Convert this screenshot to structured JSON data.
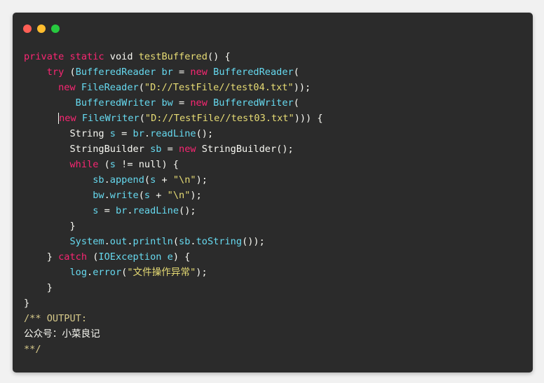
{
  "window": {
    "background": "#2b2b2b",
    "page_background": "#f1f1f1",
    "controls": [
      {
        "name": "close",
        "color": "#ff5f56"
      },
      {
        "name": "minimize",
        "color": "#ffbd2e"
      },
      {
        "name": "zoom",
        "color": "#27c93f"
      }
    ]
  },
  "code": {
    "lines": [
      [
        {
          "t": "private",
          "c": "kw"
        },
        {
          "t": " ",
          "c": "pl"
        },
        {
          "t": "static",
          "c": "kw"
        },
        {
          "t": " ",
          "c": "pl"
        },
        {
          "t": "void",
          "c": "pl"
        },
        {
          "t": " ",
          "c": "pl"
        },
        {
          "t": "testBuffered",
          "c": "fn"
        },
        {
          "t": "() {",
          "c": "pl"
        }
      ],
      [
        {
          "t": "    ",
          "c": "pl"
        },
        {
          "t": "try",
          "c": "kw"
        },
        {
          "t": " (",
          "c": "pl"
        },
        {
          "t": "BufferedReader",
          "c": "ty"
        },
        {
          "t": " ",
          "c": "pl"
        },
        {
          "t": "br",
          "c": "idn"
        },
        {
          "t": " = ",
          "c": "pl"
        },
        {
          "t": "new",
          "c": "kw"
        },
        {
          "t": " ",
          "c": "pl"
        },
        {
          "t": "BufferedReader",
          "c": "ty"
        },
        {
          "t": "(",
          "c": "pl"
        }
      ],
      [
        {
          "t": "      ",
          "c": "pl"
        },
        {
          "t": "new",
          "c": "kw"
        },
        {
          "t": " ",
          "c": "pl"
        },
        {
          "t": "FileReader",
          "c": "ty"
        },
        {
          "t": "(",
          "c": "pl"
        },
        {
          "t": "\"D://TestFile//test04.txt\"",
          "c": "str"
        },
        {
          "t": "));",
          "c": "pl"
        }
      ],
      [
        {
          "t": "         ",
          "c": "pl"
        },
        {
          "t": "BufferedWriter",
          "c": "ty"
        },
        {
          "t": " ",
          "c": "pl"
        },
        {
          "t": "bw",
          "c": "idn"
        },
        {
          "t": " = ",
          "c": "pl"
        },
        {
          "t": "new",
          "c": "kw"
        },
        {
          "t": " ",
          "c": "pl"
        },
        {
          "t": "BufferedWriter",
          "c": "ty"
        },
        {
          "t": "(",
          "c": "pl"
        }
      ],
      [
        {
          "t": "      ",
          "c": "pl"
        },
        {
          "t": "new",
          "c": "kw",
          "cursor": true
        },
        {
          "t": " ",
          "c": "pl"
        },
        {
          "t": "FileWriter",
          "c": "ty"
        },
        {
          "t": "(",
          "c": "pl"
        },
        {
          "t": "\"D://TestFile//test03.txt\"",
          "c": "str"
        },
        {
          "t": "))) {",
          "c": "pl"
        }
      ],
      [
        {
          "t": "        ",
          "c": "pl"
        },
        {
          "t": "String",
          "c": "pl"
        },
        {
          "t": " ",
          "c": "pl"
        },
        {
          "t": "s",
          "c": "idn"
        },
        {
          "t": " = ",
          "c": "pl"
        },
        {
          "t": "br",
          "c": "idn"
        },
        {
          "t": ".",
          "c": "pl"
        },
        {
          "t": "readLine",
          "c": "idn"
        },
        {
          "t": "();",
          "c": "pl"
        }
      ],
      [
        {
          "t": "        ",
          "c": "pl"
        },
        {
          "t": "StringBuilder",
          "c": "pl"
        },
        {
          "t": " ",
          "c": "pl"
        },
        {
          "t": "sb",
          "c": "idn"
        },
        {
          "t": " = ",
          "c": "pl"
        },
        {
          "t": "new",
          "c": "kw"
        },
        {
          "t": " ",
          "c": "pl"
        },
        {
          "t": "StringBuilder",
          "c": "pl"
        },
        {
          "t": "();",
          "c": "pl"
        }
      ],
      [
        {
          "t": "        ",
          "c": "pl"
        },
        {
          "t": "while",
          "c": "kw"
        },
        {
          "t": " (",
          "c": "pl"
        },
        {
          "t": "s",
          "c": "idn"
        },
        {
          "t": " != null) {",
          "c": "pl"
        }
      ],
      [
        {
          "t": "            ",
          "c": "pl"
        },
        {
          "t": "sb",
          "c": "idn"
        },
        {
          "t": ".",
          "c": "pl"
        },
        {
          "t": "append",
          "c": "idn"
        },
        {
          "t": "(",
          "c": "pl"
        },
        {
          "t": "s",
          "c": "idn"
        },
        {
          "t": " + ",
          "c": "pl"
        },
        {
          "t": "\"\\n\"",
          "c": "str"
        },
        {
          "t": ");",
          "c": "pl"
        }
      ],
      [
        {
          "t": "            ",
          "c": "pl"
        },
        {
          "t": "bw",
          "c": "idn"
        },
        {
          "t": ".",
          "c": "pl"
        },
        {
          "t": "write",
          "c": "idn"
        },
        {
          "t": "(",
          "c": "pl"
        },
        {
          "t": "s",
          "c": "idn"
        },
        {
          "t": " + ",
          "c": "pl"
        },
        {
          "t": "\"\\n\"",
          "c": "str"
        },
        {
          "t": ");",
          "c": "pl"
        }
      ],
      [
        {
          "t": "            ",
          "c": "pl"
        },
        {
          "t": "s",
          "c": "idn"
        },
        {
          "t": " = ",
          "c": "pl"
        },
        {
          "t": "br",
          "c": "idn"
        },
        {
          "t": ".",
          "c": "pl"
        },
        {
          "t": "readLine",
          "c": "idn"
        },
        {
          "t": "();",
          "c": "pl"
        }
      ],
      [
        {
          "t": "        }",
          "c": "pl"
        }
      ],
      [
        {
          "t": "        ",
          "c": "pl"
        },
        {
          "t": "System",
          "c": "idn"
        },
        {
          "t": ".",
          "c": "pl"
        },
        {
          "t": "out",
          "c": "idn"
        },
        {
          "t": ".",
          "c": "pl"
        },
        {
          "t": "println",
          "c": "idn"
        },
        {
          "t": "(",
          "c": "pl"
        },
        {
          "t": "sb",
          "c": "idn"
        },
        {
          "t": ".",
          "c": "pl"
        },
        {
          "t": "toString",
          "c": "idn"
        },
        {
          "t": "());",
          "c": "pl"
        }
      ],
      [
        {
          "t": "    } ",
          "c": "pl"
        },
        {
          "t": "catch",
          "c": "kw"
        },
        {
          "t": " (",
          "c": "pl"
        },
        {
          "t": "IOException",
          "c": "ty"
        },
        {
          "t": " ",
          "c": "pl"
        },
        {
          "t": "e",
          "c": "idn"
        },
        {
          "t": ") {",
          "c": "pl"
        }
      ],
      [
        {
          "t": "        ",
          "c": "pl"
        },
        {
          "t": "log",
          "c": "idn"
        },
        {
          "t": ".",
          "c": "pl"
        },
        {
          "t": "error",
          "c": "idn"
        },
        {
          "t": "(",
          "c": "pl"
        },
        {
          "t": "\"文件操作异常\"",
          "c": "str"
        },
        {
          "t": ");",
          "c": "pl"
        }
      ],
      [
        {
          "t": "    }",
          "c": "pl"
        }
      ],
      [
        {
          "t": "}",
          "c": "pl"
        }
      ],
      [
        {
          "t": "/** OUTPUT:",
          "c": "cm"
        }
      ],
      [
        {
          "t": "公众号：小菜良记",
          "c": "cn"
        }
      ],
      [
        {
          "t": "**/",
          "c": "cm"
        }
      ]
    ]
  }
}
